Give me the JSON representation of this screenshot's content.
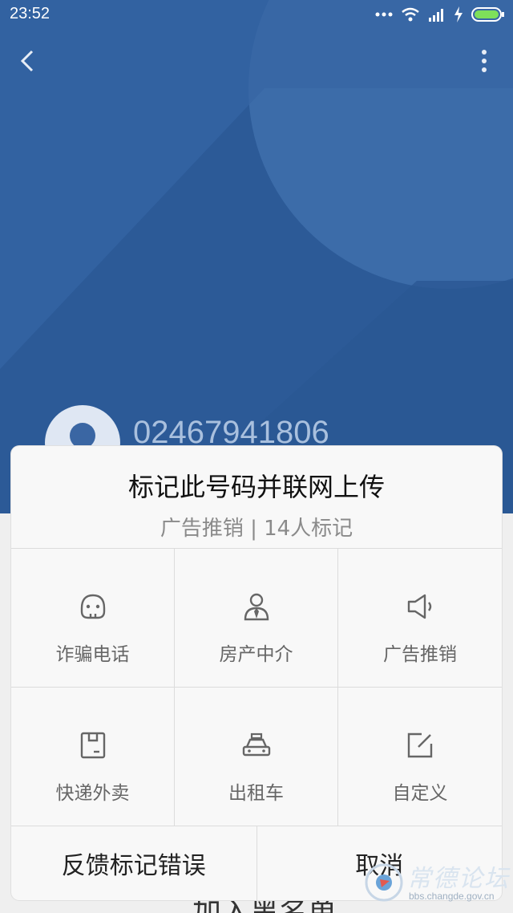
{
  "statusbar": {
    "time": "23:52"
  },
  "contact": {
    "number": "02467941806"
  },
  "dialog": {
    "title": "标记此号码并联网上传",
    "subtitle": "广告推销 | 14人标记",
    "options": [
      {
        "label": "诈骗电话",
        "icon": "fraud-face-icon"
      },
      {
        "label": "房产中介",
        "icon": "agent-person-icon"
      },
      {
        "label": "广告推销",
        "icon": "megaphone-icon"
      },
      {
        "label": "快递外卖",
        "icon": "package-box-icon"
      },
      {
        "label": "出租车",
        "icon": "taxi-icon"
      },
      {
        "label": "自定义",
        "icon": "edit-icon"
      }
    ],
    "feedback_label": "反馈标记错误",
    "cancel_label": "取消"
  },
  "background": {
    "peek_text": "加入黑名单"
  },
  "watermark": {
    "text": "常德论坛",
    "url": "bbs.changde.gov.cn"
  },
  "colors": {
    "hero": "#2f5f9f",
    "dialog_bg": "#f8f8f8",
    "icon": "#666666"
  }
}
